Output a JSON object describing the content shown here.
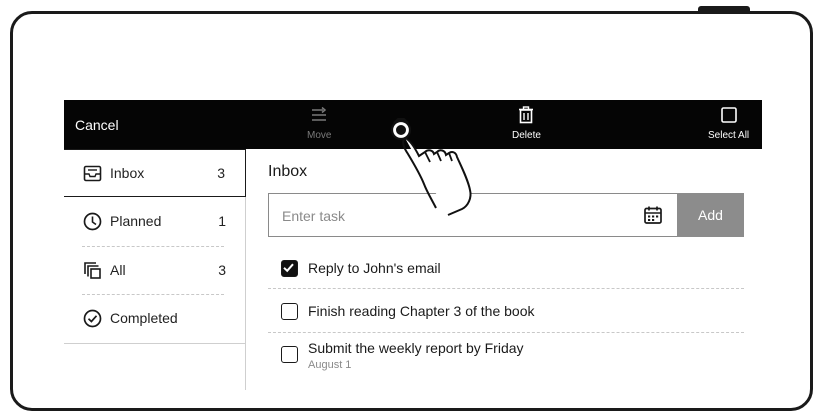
{
  "toolbar": {
    "cancel_label": "Cancel",
    "move_label": "Move",
    "delete_label": "Delete",
    "select_all_label": "Select All",
    "move_icon": "move-list-icon",
    "delete_icon": "trash-icon",
    "select_all_icon": "square-checkbox-icon"
  },
  "sidebar": {
    "items": [
      {
        "label": "Inbox",
        "count": "3",
        "icon": "inbox-icon",
        "selected": true
      },
      {
        "label": "Planned",
        "count": "1",
        "icon": "clock-icon",
        "selected": false
      },
      {
        "label": "All",
        "count": "3",
        "icon": "stack-icon",
        "selected": false
      },
      {
        "label": "Completed",
        "count": "",
        "icon": "check-circle-icon",
        "selected": false
      }
    ]
  },
  "main": {
    "title": "Inbox",
    "task_input": {
      "value": "",
      "placeholder": "Enter task"
    },
    "add_label": "Add",
    "calendar_icon": "calendar-icon",
    "tasks": [
      {
        "text": "Reply to John's email",
        "checked": true,
        "date": ""
      },
      {
        "text": "Finish reading Chapter 3 of the book",
        "checked": false,
        "date": ""
      },
      {
        "text": "Submit the weekly report by Friday",
        "checked": false,
        "date": "August 1"
      }
    ]
  },
  "colors": {
    "toolbar_bg": "#050505",
    "add_button_bg": "#8c8c8c",
    "text": "#222222"
  }
}
